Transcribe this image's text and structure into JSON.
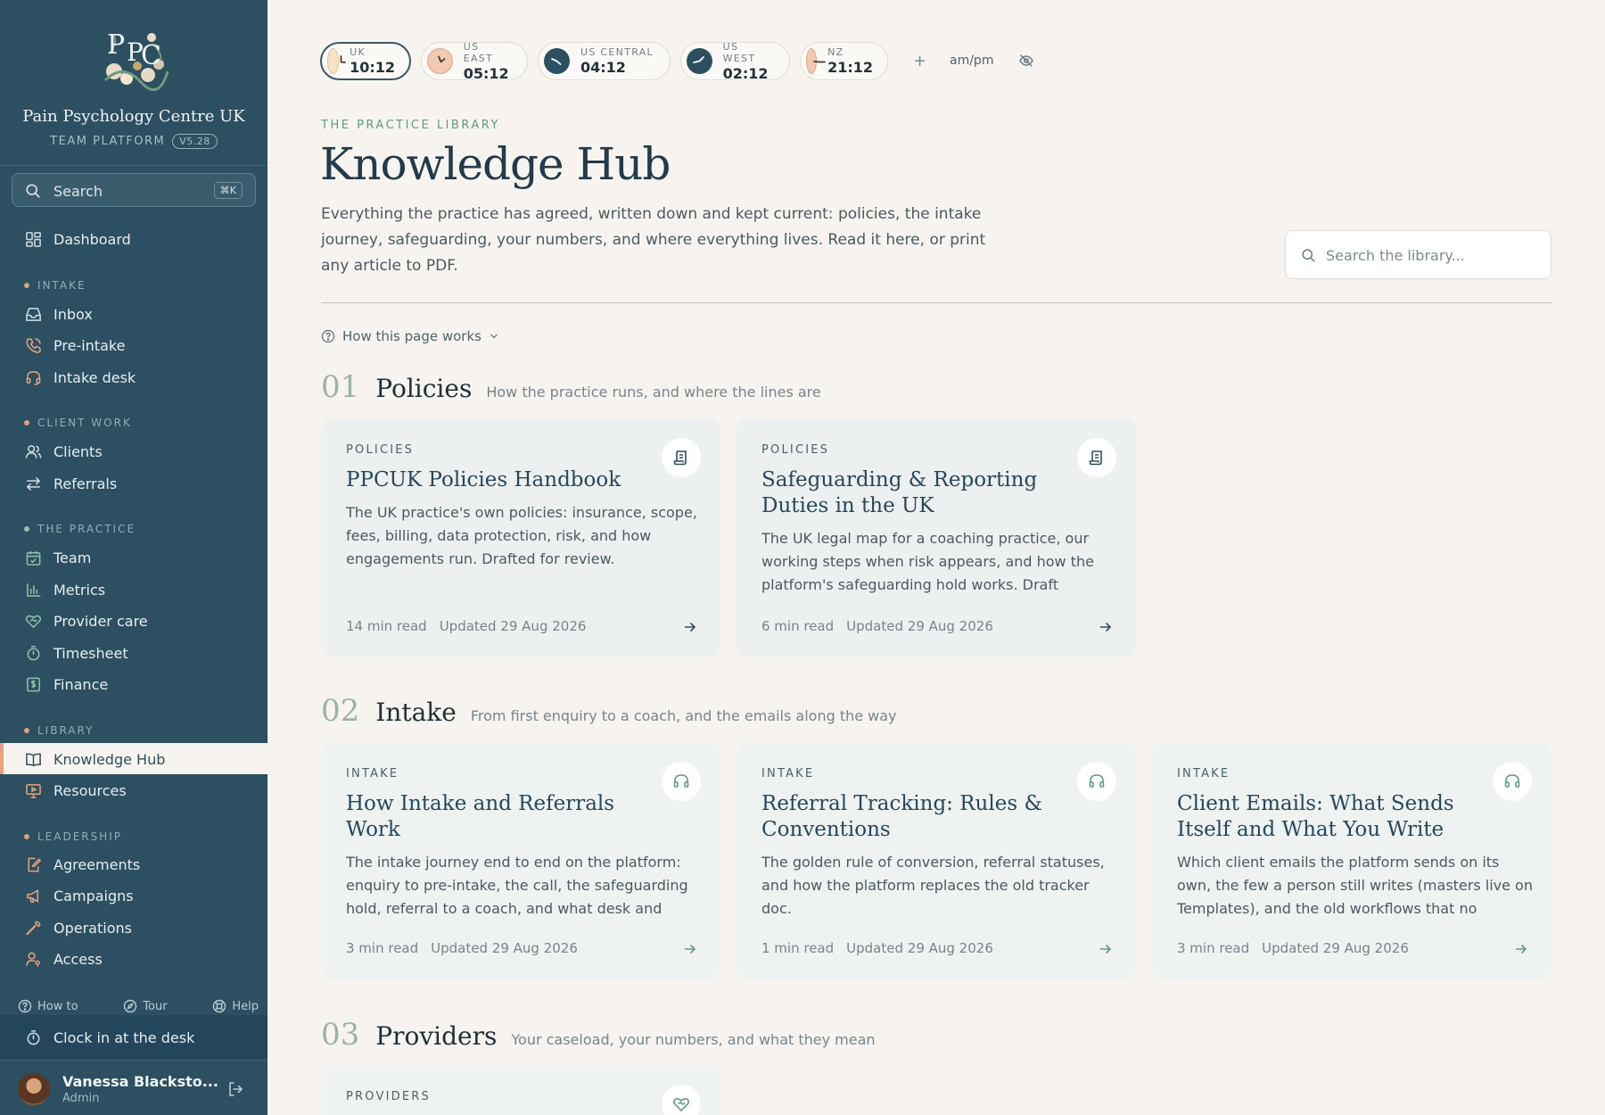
{
  "org": {
    "name": "Pain Psychology Centre UK",
    "subtitle": "TEAM PLATFORM",
    "version": "V5.28"
  },
  "sidebar": {
    "search_placeholder": "Search",
    "search_shortcut": "⌘K",
    "dashboard": "Dashboard",
    "sections": {
      "intake": "INTAKE",
      "client_work": "CLIENT WORK",
      "practice": "THE PRACTICE",
      "library": "LIBRARY",
      "leadership": "LEADERSHIP"
    },
    "items": {
      "inbox": "Inbox",
      "pre_intake": "Pre-intake",
      "intake_desk": "Intake desk",
      "clients": "Clients",
      "referrals": "Referrals",
      "team": "Team",
      "metrics": "Metrics",
      "provider_care": "Provider care",
      "timesheet": "Timesheet",
      "finance": "Finance",
      "knowledge_hub": "Knowledge Hub",
      "resources": "Resources",
      "agreements": "Agreements",
      "campaigns": "Campaigns",
      "operations": "Operations",
      "access": "Access"
    },
    "help": {
      "how_to": "How to",
      "tour": "Tour",
      "help": "Help"
    },
    "clock_in": "Clock in at the desk",
    "user": {
      "name": "Vanessa Blacksto...",
      "role": "Admin"
    }
  },
  "clocks": [
    {
      "zone": "UK",
      "time": "10:12"
    },
    {
      "zone": "US EAST",
      "time": "05:12"
    },
    {
      "zone": "US CENTRAL",
      "time": "04:12"
    },
    {
      "zone": "US WEST",
      "time": "02:12"
    },
    {
      "zone": "NZ",
      "time": "21:12"
    }
  ],
  "clock_controls": {
    "add": "+",
    "format": "am/pm"
  },
  "page": {
    "eyebrow": "THE PRACTICE LIBRARY",
    "title": "Knowledge Hub",
    "lead": "Everything the practice has agreed, written down and kept current: policies, the intake journey, safeguarding, your numbers, and where everything lives. Read it here, or print any article to PDF.",
    "search_placeholder": "Search the library...",
    "how_this_works": "How this page works"
  },
  "sections": [
    {
      "num": "01",
      "name": "Policies",
      "desc": "How the practice runs, and where the lines are"
    },
    {
      "num": "02",
      "name": "Intake",
      "desc": "From first enquiry to a coach, and the emails along the way"
    },
    {
      "num": "03",
      "name": "Providers",
      "desc": "Your caseload, your numbers, and what they mean"
    }
  ],
  "cards": {
    "policies": [
      {
        "category": "POLICIES",
        "title": "PPCUK Policies Handbook",
        "desc": "The UK practice's own policies: insurance, scope, fees, billing, data protection, risk, and how engagements run. Drafted for review.",
        "read": "14 min read",
        "updated": "Updated 29 Aug 2026"
      },
      {
        "category": "POLICIES",
        "title": "Safeguarding & Reporting Duties in the UK",
        "desc": "The UK legal map for a coaching practice, our working steps when risk appears, and how the platform's safeguarding hold works. Draft awaitin...",
        "read": "6 min read",
        "updated": "Updated 29 Aug 2026"
      }
    ],
    "intake": [
      {
        "category": "INTAKE",
        "title": "How Intake and Referrals Work",
        "desc": "The intake journey end to end on the platform: enquiry to pre-intake, the call, the safeguarding hold, referral to a coach, and what desk and coac...",
        "read": "3 min read",
        "updated": "Updated 29 Aug 2026"
      },
      {
        "category": "INTAKE",
        "title": "Referral Tracking: Rules & Conventions",
        "desc": "The golden rule of conversion, referral statuses, and how the platform replaces the old tracker doc.",
        "read": "1 min read",
        "updated": "Updated 29 Aug 2026"
      },
      {
        "category": "INTAKE",
        "title": "Client Emails: What Sends Itself and What You Write",
        "desc": "Which client emails the platform sends on its own, the few a person still writes (masters live on Templates), and the old workflows that no longer...",
        "read": "3 min read",
        "updated": "Updated 29 Aug 2026"
      }
    ],
    "providers": [
      {
        "category": "PROVIDERS"
      }
    ]
  }
}
